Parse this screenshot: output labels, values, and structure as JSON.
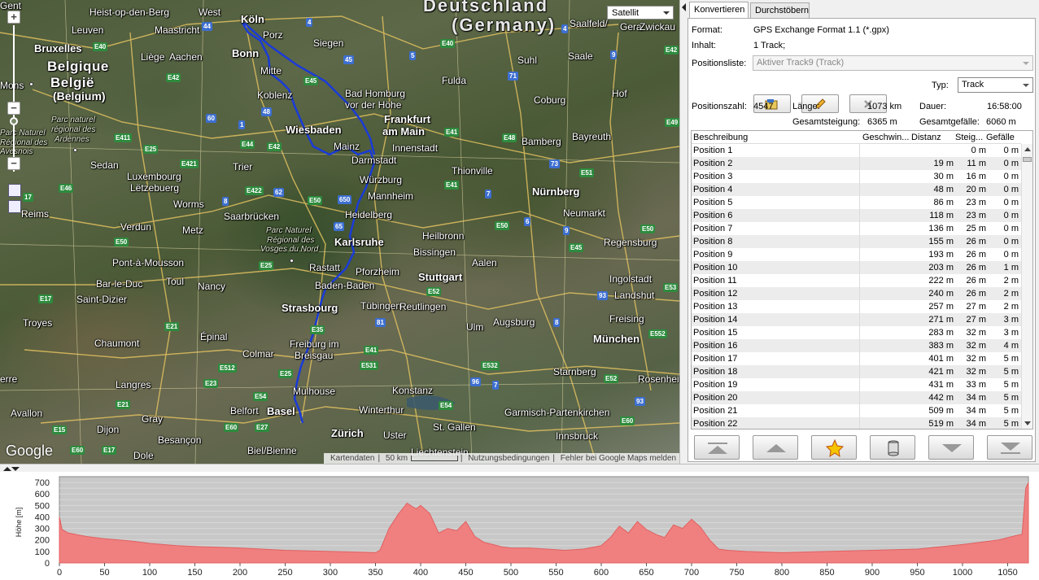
{
  "map": {
    "type_select": "Satellit",
    "google_logo": "Google",
    "attribution": {
      "map_data": "Kartendaten",
      "scale": "50 km",
      "terms": "Nutzungsbedingungen",
      "report": "Fehler bei Google Maps melden"
    },
    "labels": [
      {
        "text": "Gent",
        "cls": "city"
      },
      {
        "text": "Heist-op-den-Berg",
        "cls": "city"
      },
      {
        "text": "West",
        "cls": "city"
      },
      {
        "text": "Köln",
        "cls": "city big"
      },
      {
        "text": "Porz",
        "cls": "city"
      },
      {
        "text": "Deutschland",
        "cls": "city huge"
      },
      {
        "text": "(Germany)",
        "cls": "city huge"
      },
      {
        "text": "Gera",
        "cls": "city"
      },
      {
        "text": "Zwickau",
        "cls": "city"
      },
      {
        "text": "Leuven",
        "cls": "city"
      },
      {
        "text": "Maastricht",
        "cls": "city"
      },
      {
        "text": "Siegen",
        "cls": "city"
      },
      {
        "text": "Saalfeld/",
        "cls": "city"
      },
      {
        "text": "Saale",
        "cls": "city"
      },
      {
        "text": "Bruxelles",
        "cls": "city big"
      },
      {
        "text": "Liège",
        "cls": "city"
      },
      {
        "text": "Aachen",
        "cls": "city"
      },
      {
        "text": "Bonn",
        "cls": "city big"
      },
      {
        "text": "Suhl",
        "cls": "city"
      },
      {
        "text": "Belgique",
        "cls": "city country"
      },
      {
        "text": "België",
        "cls": "city country"
      },
      {
        "text": "(Belgium)",
        "cls": "city country2"
      },
      {
        "text": "Mitte",
        "cls": "city"
      },
      {
        "text": "Fulda",
        "cls": "city"
      },
      {
        "text": "Mons",
        "cls": "city"
      },
      {
        "text": "Bad Homburg",
        "cls": "city"
      },
      {
        "text": "vor der Höhe",
        "cls": "city"
      },
      {
        "text": "Koblenz",
        "cls": "city"
      },
      {
        "text": "Coburg",
        "cls": "city"
      },
      {
        "text": "Hof",
        "cls": "city"
      },
      {
        "text": "Frankfurt",
        "cls": "city big"
      },
      {
        "text": "am Main",
        "cls": "city big"
      },
      {
        "text": "Parc naturel",
        "cls": "city region"
      },
      {
        "text": "régional des",
        "cls": "city region"
      },
      {
        "text": "Ardennes",
        "cls": "city region"
      },
      {
        "text": "Wiesbaden",
        "cls": "city big"
      },
      {
        "text": "Bayreuth",
        "cls": "city"
      },
      {
        "text": "Mainz",
        "cls": "city"
      },
      {
        "text": "Innenstadt",
        "cls": "city"
      },
      {
        "text": "Bamberg",
        "cls": "city"
      },
      {
        "text": "Parc Naturel",
        "cls": "city region"
      },
      {
        "text": "Régional des",
        "cls": "city region"
      },
      {
        "text": "Avesnois",
        "cls": "city region"
      },
      {
        "text": "Sedan",
        "cls": "city"
      },
      {
        "text": "Darmstadt",
        "cls": "city"
      },
      {
        "text": "Trier",
        "cls": "city"
      },
      {
        "text": "Luxembourg",
        "cls": "city"
      },
      {
        "text": "Lëtzebuerg",
        "cls": "city"
      },
      {
        "text": "Worms",
        "cls": "city"
      },
      {
        "text": "Würzburg",
        "cls": "city"
      },
      {
        "text": "Thionville",
        "cls": "city"
      },
      {
        "text": "Mannheim",
        "cls": "city"
      },
      {
        "text": "Nürnberg",
        "cls": "city big"
      },
      {
        "text": "Reims",
        "cls": "city"
      },
      {
        "text": "Saarbrücken",
        "cls": "city"
      },
      {
        "text": "Heidelberg",
        "cls": "city"
      },
      {
        "text": "Neumarkt",
        "cls": "city"
      },
      {
        "text": "Verdun",
        "cls": "city"
      },
      {
        "text": "Metz",
        "cls": "city"
      },
      {
        "text": "Parc Naturel",
        "cls": "city region"
      },
      {
        "text": "Régional des",
        "cls": "city region"
      },
      {
        "text": "Vosges du Nord",
        "cls": "city region"
      },
      {
        "text": "Heilbronn",
        "cls": "city"
      },
      {
        "text": "Karlsruhe",
        "cls": "city big"
      },
      {
        "text": "Regensburg",
        "cls": "city"
      },
      {
        "text": "Bissingen",
        "cls": "city"
      },
      {
        "text": "Pont-à-Mousson",
        "cls": "city"
      },
      {
        "text": "Rastatt",
        "cls": "city"
      },
      {
        "text": "Pforzheim",
        "cls": "city"
      },
      {
        "text": "Stuttgart",
        "cls": "city big"
      },
      {
        "text": "Aalen",
        "cls": "city"
      },
      {
        "text": "Ingolstadt",
        "cls": "city"
      },
      {
        "text": "Bar-le-Duc",
        "cls": "city"
      },
      {
        "text": "Toul",
        "cls": "city"
      },
      {
        "text": "Nancy",
        "cls": "city"
      },
      {
        "text": "Baden-Baden",
        "cls": "city"
      },
      {
        "text": "Landshut",
        "cls": "city"
      },
      {
        "text": "Saint-Dizier",
        "cls": "city"
      },
      {
        "text": "Strasbourg",
        "cls": "city big"
      },
      {
        "text": "Tübingen",
        "cls": "city"
      },
      {
        "text": "Reutlingen",
        "cls": "city"
      },
      {
        "text": "Troyes",
        "cls": "city"
      },
      {
        "text": "Augsburg",
        "cls": "city"
      },
      {
        "text": "Freising",
        "cls": "city"
      },
      {
        "text": "Ulm",
        "cls": "city"
      },
      {
        "text": "Épinal",
        "cls": "city"
      },
      {
        "text": "Chaumont",
        "cls": "city"
      },
      {
        "text": "München",
        "cls": "city big"
      },
      {
        "text": "Freiburg im",
        "cls": "city"
      },
      {
        "text": "Breisgau",
        "cls": "city"
      },
      {
        "text": "Colmar",
        "cls": "city"
      },
      {
        "text": "Starnberg",
        "cls": "city"
      },
      {
        "text": "Rosenheim",
        "cls": "city"
      },
      {
        "text": "Langres",
        "cls": "city"
      },
      {
        "text": "Mulhouse",
        "cls": "city"
      },
      {
        "text": "Konstanz",
        "cls": "city"
      },
      {
        "text": "Belfort",
        "cls": "city"
      },
      {
        "text": "Basel",
        "cls": "city big"
      },
      {
        "text": "Winterthur",
        "cls": "city"
      },
      {
        "text": "Garmisch-Partenkirchen",
        "cls": "city"
      },
      {
        "text": "Gray",
        "cls": "city"
      },
      {
        "text": "Avallon",
        "cls": "city"
      },
      {
        "text": "Dijon",
        "cls": "city"
      },
      {
        "text": "St. Gallen",
        "cls": "city"
      },
      {
        "text": "Zürich",
        "cls": "city big"
      },
      {
        "text": "Uster",
        "cls": "city"
      },
      {
        "text": "Besançon",
        "cls": "city"
      },
      {
        "text": "Innsbruck",
        "cls": "city"
      },
      {
        "text": "Biel/Bienne",
        "cls": "city"
      },
      {
        "text": "Dole",
        "cls": "city"
      },
      {
        "text": "Liechtenstein",
        "cls": "city"
      },
      {
        "text": "erre",
        "cls": "city"
      }
    ],
    "shields": [
      {
        "text": "4",
        "c": "b"
      },
      {
        "text": "44",
        "c": "b"
      },
      {
        "text": "4",
        "c": "b"
      },
      {
        "text": "E40",
        "c": "g"
      },
      {
        "text": "E40",
        "c": "g"
      },
      {
        "text": "45",
        "c": "b"
      },
      {
        "text": "5",
        "c": "b"
      },
      {
        "text": "9",
        "c": "b"
      },
      {
        "text": "E42",
        "c": "g"
      },
      {
        "text": "E45",
        "c": "g"
      },
      {
        "text": "71",
        "c": "b"
      },
      {
        "text": "E42",
        "c": "g"
      },
      {
        "text": "60",
        "c": "b"
      },
      {
        "text": "1",
        "c": "b"
      },
      {
        "text": "48",
        "c": "b"
      },
      {
        "text": "E44",
        "c": "g"
      },
      {
        "text": "E42",
        "c": "g"
      },
      {
        "text": "E411",
        "c": "g"
      },
      {
        "text": "E25",
        "c": "g"
      },
      {
        "text": "E421",
        "c": "g"
      },
      {
        "text": "E46",
        "c": "g"
      },
      {
        "text": "E422",
        "c": "g"
      },
      {
        "text": "62",
        "c": "b"
      },
      {
        "text": "8",
        "c": "b"
      },
      {
        "text": "E50",
        "c": "g"
      },
      {
        "text": "650",
        "c": "b"
      },
      {
        "text": "65",
        "c": "b"
      },
      {
        "text": "73",
        "c": "b"
      },
      {
        "text": "E48",
        "c": "g"
      },
      {
        "text": "E41",
        "c": "g"
      },
      {
        "text": "7",
        "c": "b"
      },
      {
        "text": "6",
        "c": "b"
      },
      {
        "text": "E50",
        "c": "g"
      },
      {
        "text": "9",
        "c": "b"
      },
      {
        "text": "E45",
        "c": "g"
      },
      {
        "text": "E50",
        "c": "g"
      },
      {
        "text": "E25",
        "c": "g"
      },
      {
        "text": "E52",
        "c": "g"
      },
      {
        "text": "93",
        "c": "b"
      },
      {
        "text": "E53",
        "c": "g"
      },
      {
        "text": "81",
        "c": "b"
      },
      {
        "text": "8",
        "c": "b"
      },
      {
        "text": "E552",
        "c": "g"
      },
      {
        "text": "E21",
        "c": "g"
      },
      {
        "text": "E35",
        "c": "g"
      },
      {
        "text": "E41",
        "c": "g"
      },
      {
        "text": "E531",
        "c": "g"
      },
      {
        "text": "E512",
        "c": "g"
      },
      {
        "text": "E532",
        "c": "g"
      },
      {
        "text": "E23",
        "c": "g"
      },
      {
        "text": "E25",
        "c": "g"
      },
      {
        "text": "96",
        "c": "b"
      },
      {
        "text": "7",
        "c": "b"
      },
      {
        "text": "E52",
        "c": "g"
      },
      {
        "text": "E54",
        "c": "g"
      },
      {
        "text": "E54",
        "c": "g"
      },
      {
        "text": "E21",
        "c": "g"
      },
      {
        "text": "93",
        "c": "b"
      },
      {
        "text": "E15",
        "c": "g"
      },
      {
        "text": "E60",
        "c": "g"
      },
      {
        "text": "E27",
        "c": "g"
      },
      {
        "text": "E60",
        "c": "g"
      },
      {
        "text": "E60",
        "c": "g"
      },
      {
        "text": "E17",
        "c": "g"
      },
      {
        "text": "E17",
        "c": "g"
      },
      {
        "text": "E50",
        "c": "g"
      },
      {
        "text": "E49",
        "c": "g"
      },
      {
        "text": "E41",
        "c": "g"
      },
      {
        "text": "17",
        "c": "g"
      },
      {
        "text": "E51",
        "c": "g"
      }
    ]
  },
  "panel": {
    "tabs": [
      "Konvertieren",
      "Durchstöbern"
    ],
    "format_label": "Format:",
    "format_value": "GPS Exchange Format 1.1 (*.gpx)",
    "content_label": "Inhalt:",
    "content_value": "1 Track;",
    "poslist_label": "Positionsliste:",
    "poslist_value": "Aktiver Track9 (Track)",
    "type_label": "Typ:",
    "type_value": "Track",
    "count_label": "Positionszahl:",
    "count_value": "4547",
    "length_label": "Länge:",
    "length_value": "1073 km",
    "duration_label": "Dauer:",
    "duration_value": "16:58:00",
    "ascent_label": "Gesamtsteigung:",
    "ascent_value": "6365 m",
    "descent_label": "Gesamtgefälle:",
    "descent_value": "6060 m",
    "toolbar_icons": [
      "open-file-icon",
      "edit-pencil-icon",
      "delete-x-icon"
    ],
    "columns": [
      "Beschreibung",
      "Geschwin...",
      "Distanz",
      "Steig...",
      "Gefälle"
    ],
    "rows": [
      [
        "Position 1",
        "",
        "0 m",
        "0 m"
      ],
      [
        "Position 2",
        "19 m",
        "11 m",
        "0 m"
      ],
      [
        "Position 3",
        "30 m",
        "16 m",
        "0 m"
      ],
      [
        "Position 4",
        "48 m",
        "20 m",
        "0 m"
      ],
      [
        "Position 5",
        "86 m",
        "23 m",
        "0 m"
      ],
      [
        "Position 6",
        "118 m",
        "23 m",
        "0 m"
      ],
      [
        "Position 7",
        "136 m",
        "25 m",
        "0 m"
      ],
      [
        "Position 8",
        "155 m",
        "26 m",
        "0 m"
      ],
      [
        "Position 9",
        "193 m",
        "26 m",
        "0 m"
      ],
      [
        "Position 10",
        "203 m",
        "26 m",
        "1 m"
      ],
      [
        "Position 11",
        "222 m",
        "26 m",
        "2 m"
      ],
      [
        "Position 12",
        "240 m",
        "26 m",
        "2 m"
      ],
      [
        "Position 13",
        "257 m",
        "27 m",
        "2 m"
      ],
      [
        "Position 14",
        "271 m",
        "27 m",
        "3 m"
      ],
      [
        "Position 15",
        "283 m",
        "32 m",
        "3 m"
      ],
      [
        "Position 16",
        "383 m",
        "32 m",
        "4 m"
      ],
      [
        "Position 17",
        "401 m",
        "32 m",
        "5 m"
      ],
      [
        "Position 18",
        "421 m",
        "32 m",
        "5 m"
      ],
      [
        "Position 19",
        "431 m",
        "33 m",
        "5 m"
      ],
      [
        "Position 20",
        "442 m",
        "34 m",
        "5 m"
      ],
      [
        "Position 21",
        "509 m",
        "34 m",
        "5 m"
      ],
      [
        "Position 22",
        "519 m",
        "34 m",
        "5 m"
      ]
    ],
    "nav_icons": [
      "first-icon",
      "up-icon",
      "mark-icon",
      "database-icon",
      "down-icon",
      "last-icon"
    ]
  },
  "chart_data": {
    "type": "area",
    "ylabel": "Höhe [m]",
    "xlim": [
      0,
      1073
    ],
    "ylim": [
      0,
      750
    ],
    "yticks": [
      0,
      50,
      100,
      150,
      200,
      250,
      300,
      350,
      400,
      450,
      500,
      550,
      600,
      650,
      700
    ],
    "xticks": [
      0,
      50,
      100,
      150,
      200,
      250,
      300,
      350,
      400,
      450,
      500,
      550,
      600,
      650,
      700,
      750,
      800,
      850,
      900,
      950,
      1000,
      1050
    ],
    "fill_color": "#f08080",
    "x": [
      0,
      3,
      10,
      30,
      50,
      80,
      100,
      130,
      160,
      200,
      250,
      300,
      330,
      350,
      355,
      365,
      375,
      385,
      395,
      400,
      410,
      420,
      430,
      440,
      450,
      460,
      470,
      480,
      490,
      500,
      520,
      540,
      560,
      580,
      600,
      610,
      620,
      630,
      640,
      650,
      660,
      670,
      680,
      690,
      700,
      710,
      720,
      730,
      740,
      760,
      800,
      850,
      900,
      950,
      1000,
      1040,
      1060,
      1066,
      1070,
      1073
    ],
    "y": [
      400,
      290,
      260,
      230,
      210,
      190,
      170,
      150,
      140,
      130,
      110,
      100,
      95,
      90,
      110,
      300,
      420,
      520,
      470,
      500,
      430,
      260,
      300,
      280,
      360,
      230,
      180,
      160,
      140,
      130,
      130,
      120,
      110,
      120,
      150,
      220,
      320,
      260,
      360,
      290,
      250,
      220,
      330,
      300,
      380,
      310,
      200,
      120,
      110,
      100,
      90,
      100,
      110,
      120,
      160,
      200,
      240,
      250,
      650,
      700
    ]
  }
}
